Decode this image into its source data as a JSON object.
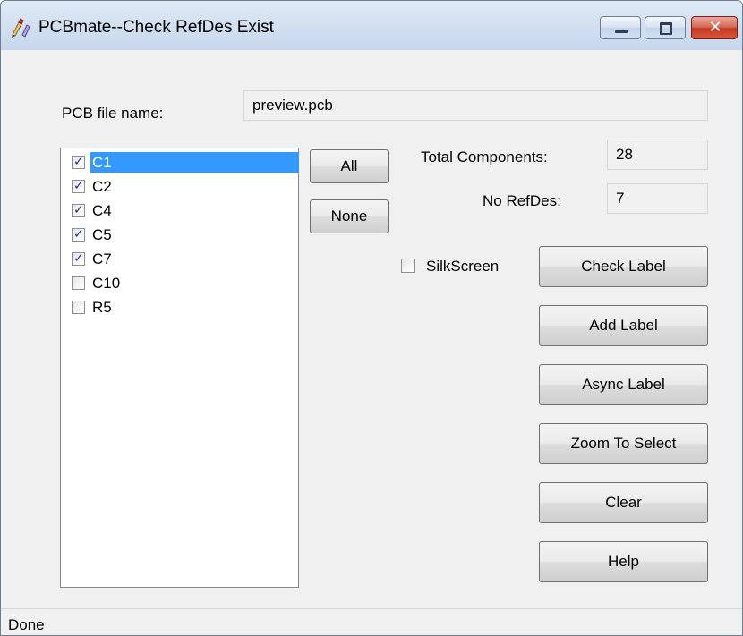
{
  "window": {
    "title": "PCBmate--Check RefDes Exist",
    "minimize_glyph": "",
    "close_glyph": "✕"
  },
  "form": {
    "pcb_file_label": "PCB file name:",
    "pcb_file_value": "preview.pcb",
    "total_components_label": "Total Components:",
    "total_components_value": "28",
    "no_refdes_label": "No RefDes:",
    "no_refdes_value": "7"
  },
  "components": [
    {
      "label": "C1",
      "checked": true,
      "selected": true
    },
    {
      "label": "C2",
      "checked": true,
      "selected": false
    },
    {
      "label": "C4",
      "checked": true,
      "selected": false
    },
    {
      "label": "C5",
      "checked": true,
      "selected": false
    },
    {
      "label": "C7",
      "checked": true,
      "selected": false
    },
    {
      "label": "C10",
      "checked": false,
      "selected": false
    },
    {
      "label": "R5",
      "checked": false,
      "selected": false
    }
  ],
  "selection_buttons": {
    "all": "All",
    "none": "None"
  },
  "silkscreen": {
    "label": "SilkScreen",
    "checked": false
  },
  "actions": {
    "check_label": "Check Label",
    "add_label": "Add Label",
    "async_label": "Async Label",
    "zoom_to_select": "Zoom To Select",
    "clear": "Clear",
    "help": "Help"
  },
  "status": {
    "text": "Done"
  },
  "colors": {
    "selection": "#3399ff",
    "close_button": "#c5391f",
    "title_bar": "#d3e1f1"
  }
}
